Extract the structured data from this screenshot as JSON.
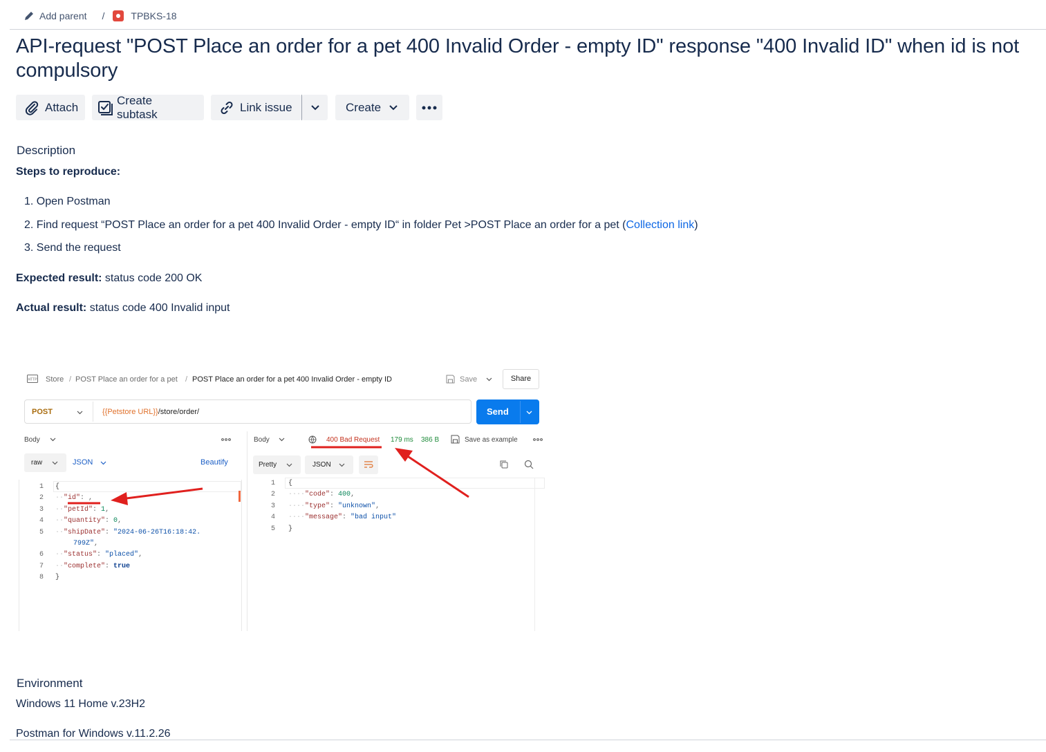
{
  "breadcrumb": {
    "add_parent": "Add parent",
    "separator": "/",
    "issue_key": "TPBKS-18"
  },
  "issue": {
    "title": "API-request \"POST Place an order for a pet 400 Invalid Order - empty ID\" response \"400 Invalid ID\" when id is not compulsory"
  },
  "toolbar": {
    "attach": "Attach",
    "create_subtask": "Create subtask",
    "link_issue": "Link issue",
    "create": "Create"
  },
  "description": {
    "heading": "Description",
    "steps_heading": "Steps to reproduce:",
    "steps": [
      "Open Postman",
      "Find request “POST Place an order for a pet 400 Invalid Order - empty ID“ in folder Pet >POST Place an order for a pet (",
      "Send the request"
    ],
    "step2_link": "Collection link",
    "step2_close": ")",
    "expected_label": "Expected result:",
    "expected_value": " status code 200 OK",
    "actual_label": "Actual result:",
    "actual_value": " status code 400 Invalid input"
  },
  "screenshot": {
    "crumb_store": "Store",
    "crumb_sep": "/",
    "crumb_folder": "POST Place an order for a pet",
    "crumb_request": "POST Place an order for a pet 400 Invalid Order - empty ID",
    "save": "Save",
    "share": "Share",
    "method": "POST",
    "url_var": "{{Petstore URL}}",
    "url_path": "/store/order/",
    "send": "Send",
    "body_label": "Body",
    "raw": "raw",
    "json": "JSON",
    "beautify": "Beautify",
    "request_lines": [
      {
        "n": "1",
        "t": "{"
      },
      {
        "n": "2",
        "t": "\"id\": ,"
      },
      {
        "n": "3",
        "t": "\"petId\": 1,"
      },
      {
        "n": "4",
        "t": "\"quantity\": 0,"
      },
      {
        "n": "5",
        "t": "\"shipDate\": \"2024-06-26T16:18:42."
      },
      {
        "n": "",
        "t": "799Z\","
      },
      {
        "n": "6",
        "t": "\"status\": \"placed\","
      },
      {
        "n": "7",
        "t": "\"complete\": true"
      },
      {
        "n": "8",
        "t": "}"
      }
    ],
    "status": "400 Bad Request",
    "time": "179 ms",
    "size": "386 B",
    "save_as_example": "Save as example",
    "pretty": "Pretty",
    "response_lines": [
      {
        "n": "1",
        "t": "{"
      },
      {
        "n": "2",
        "t": "\"code\": 400,"
      },
      {
        "n": "3",
        "t": "\"type\": \"unknown\","
      },
      {
        "n": "4",
        "t": "\"message\": \"bad input\""
      },
      {
        "n": "5",
        "t": "}"
      }
    ]
  },
  "environment": {
    "heading": "Environment",
    "os": "Windows 11 Home v.23H2",
    "app": "Postman for Windows v.11.2.26"
  },
  "colors": {
    "text": "#172b4d",
    "link": "#0c66e4",
    "button_bg": "#f1f2f4",
    "issue_icon": "#e2483d",
    "postman_send": "#097bed",
    "annotation_red": "#e0201e"
  }
}
